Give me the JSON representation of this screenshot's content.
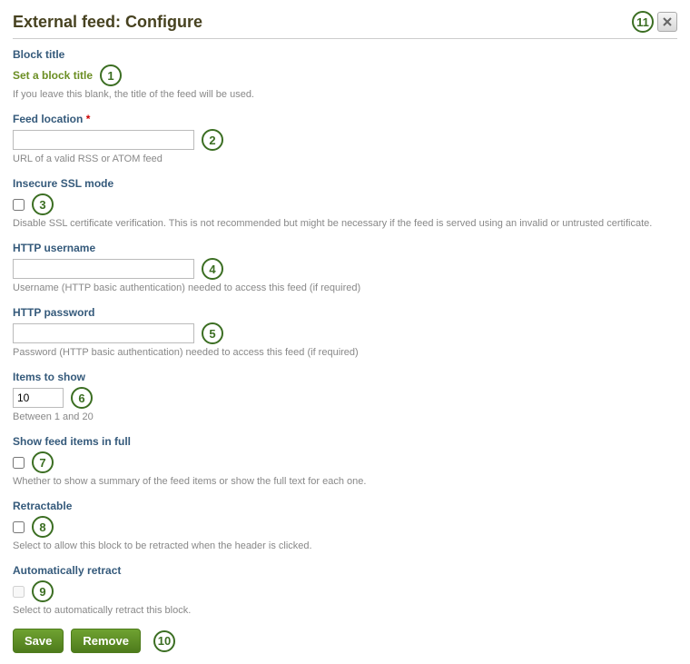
{
  "header": {
    "title": "External feed: Configure"
  },
  "annotations": {
    "a1": "1",
    "a2": "2",
    "a3": "3",
    "a4": "4",
    "a5": "5",
    "a6": "6",
    "a7": "7",
    "a8": "8",
    "a9": "9",
    "a10": "10",
    "a11": "11"
  },
  "block_title": {
    "label": "Block title",
    "action": "Set a block title",
    "desc": "If you leave this blank, the title of the feed will be used."
  },
  "feed_location": {
    "label": "Feed location",
    "required": "*",
    "value": "",
    "desc": "URL of a valid RSS or ATOM feed"
  },
  "insecure_ssl": {
    "label": "Insecure SSL mode",
    "checked": false,
    "desc": "Disable SSL certificate verification. This is not recommended but might be necessary if the feed is served using an invalid or untrusted certificate."
  },
  "http_user": {
    "label": "HTTP username",
    "value": "",
    "desc": "Username (HTTP basic authentication) needed to access this feed (if required)"
  },
  "http_pass": {
    "label": "HTTP password",
    "value": "",
    "desc": "Password (HTTP basic authentication) needed to access this feed (if required)"
  },
  "items": {
    "label": "Items to show",
    "value": "10",
    "desc": "Between 1 and 20"
  },
  "show_full": {
    "label": "Show feed items in full",
    "checked": false,
    "desc": "Whether to show a summary of the feed items or show the full text for each one."
  },
  "retractable": {
    "label": "Retractable",
    "checked": false,
    "desc": "Select to allow this block to be retracted when the header is clicked."
  },
  "auto_retract": {
    "label": "Automatically retract",
    "checked": false,
    "desc": "Select to automatically retract this block."
  },
  "buttons": {
    "save": "Save",
    "remove": "Remove"
  }
}
